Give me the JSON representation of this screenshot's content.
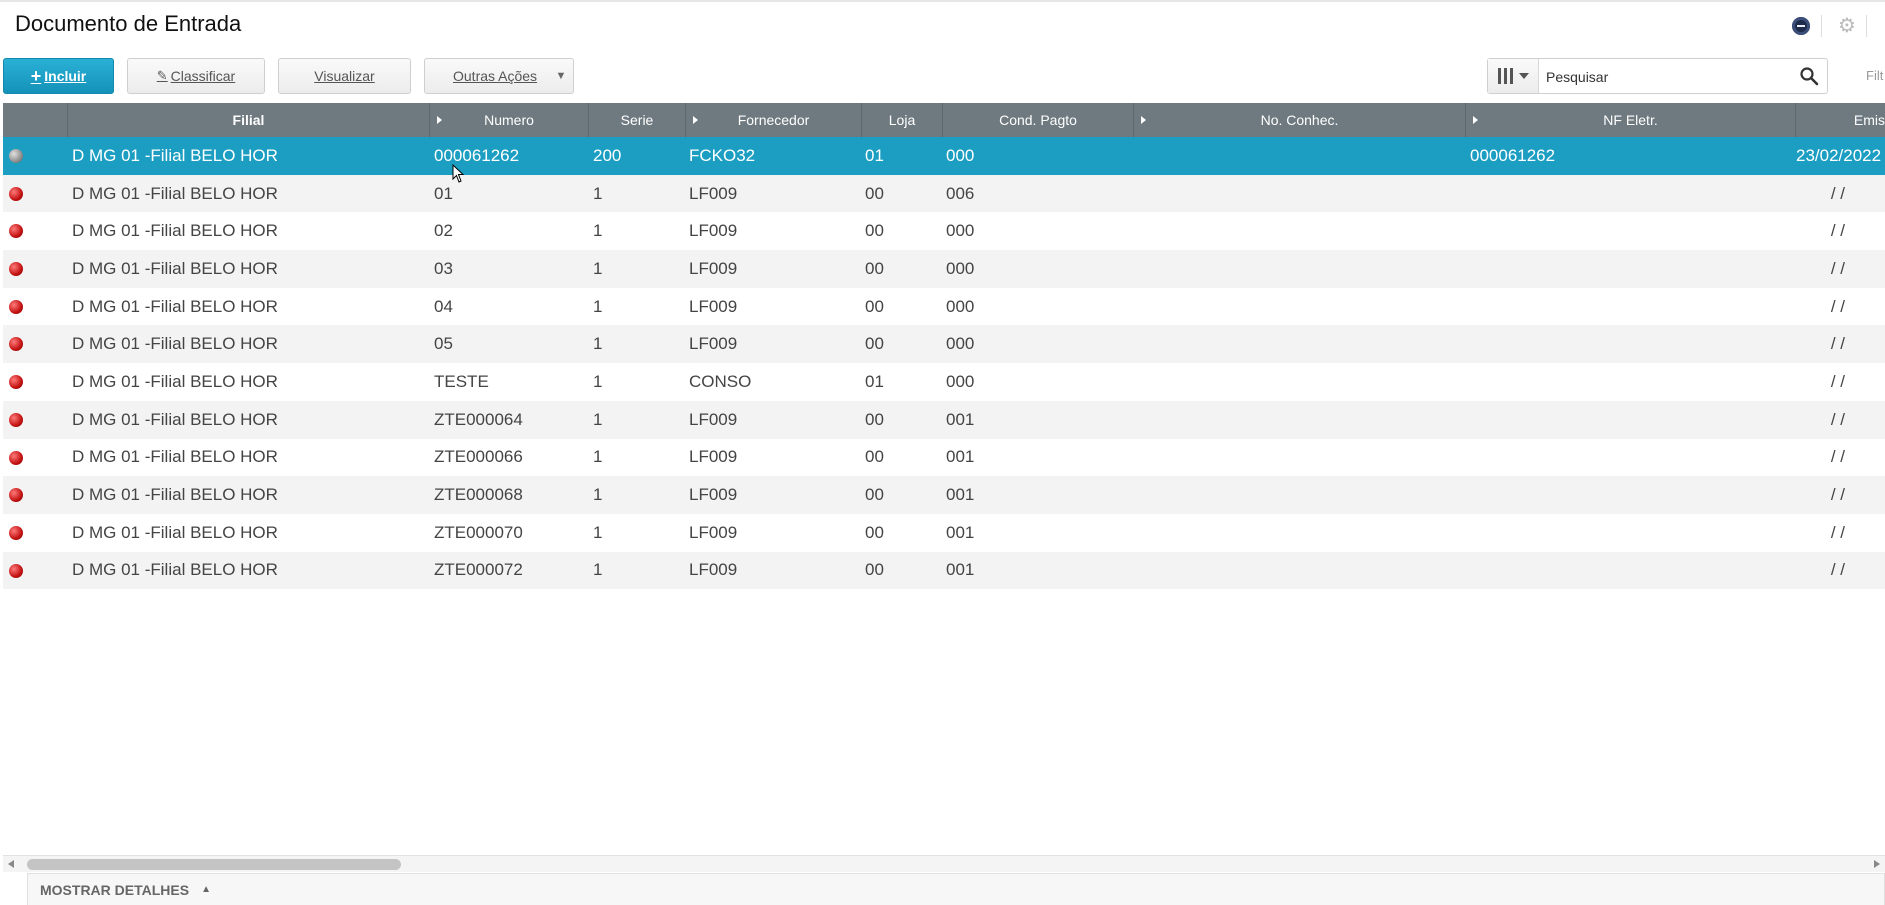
{
  "page": {
    "title": "Documento de Entrada"
  },
  "toolbar": {
    "incluir": "Incluir",
    "classificar": "Classificar",
    "visualizar": "Visualizar",
    "outras": "Outras Ações"
  },
  "search": {
    "placeholder": "Pesquisar",
    "filter_label": "Filt"
  },
  "grid": {
    "headers": [
      "",
      "Filial",
      "Numero",
      "Serie",
      "Fornecedor",
      "Loja",
      "Cond. Pagto",
      "No. Conhec.",
      "NF Eletr.",
      "Emis"
    ],
    "rows": [
      {
        "status": "gray",
        "filial": "D MG 01 -Filial BELO HOR",
        "numero": "000061262",
        "serie": "200",
        "fornecedor": "FCKO32",
        "loja": "01",
        "cond": "000",
        "conhec": "",
        "nfe": "000061262",
        "emis": "23/02/2022",
        "selected": true
      },
      {
        "status": "red",
        "filial": "D MG 01 -Filial BELO HOR",
        "numero": "01",
        "serie": "1",
        "fornecedor": "LF009",
        "loja": "00",
        "cond": "006",
        "conhec": "",
        "nfe": "",
        "emis": "/ /"
      },
      {
        "status": "red",
        "filial": "D MG 01 -Filial BELO HOR",
        "numero": "02",
        "serie": "1",
        "fornecedor": "LF009",
        "loja": "00",
        "cond": "000",
        "conhec": "",
        "nfe": "",
        "emis": "/ /"
      },
      {
        "status": "red",
        "filial": "D MG 01 -Filial BELO HOR",
        "numero": "03",
        "serie": "1",
        "fornecedor": "LF009",
        "loja": "00",
        "cond": "000",
        "conhec": "",
        "nfe": "",
        "emis": "/ /"
      },
      {
        "status": "red",
        "filial": "D MG 01 -Filial BELO HOR",
        "numero": "04",
        "serie": "1",
        "fornecedor": "LF009",
        "loja": "00",
        "cond": "000",
        "conhec": "",
        "nfe": "",
        "emis": "/ /"
      },
      {
        "status": "red",
        "filial": "D MG 01 -Filial BELO HOR",
        "numero": "05",
        "serie": "1",
        "fornecedor": "LF009",
        "loja": "00",
        "cond": "000",
        "conhec": "",
        "nfe": "",
        "emis": "/ /"
      },
      {
        "status": "red",
        "filial": "D MG 01 -Filial BELO HOR",
        "numero": "TESTE",
        "serie": "1",
        "fornecedor": "CONSO",
        "loja": "01",
        "cond": "000",
        "conhec": "",
        "nfe": "",
        "emis": "/ /"
      },
      {
        "status": "red",
        "filial": "D MG 01 -Filial BELO HOR",
        "numero": "ZTE000064",
        "serie": "1",
        "fornecedor": "LF009",
        "loja": "00",
        "cond": "001",
        "conhec": "",
        "nfe": "",
        "emis": "/ /"
      },
      {
        "status": "red",
        "filial": "D MG 01 -Filial BELO HOR",
        "numero": "ZTE000066",
        "serie": "1",
        "fornecedor": "LF009",
        "loja": "00",
        "cond": "001",
        "conhec": "",
        "nfe": "",
        "emis": "/ /"
      },
      {
        "status": "red",
        "filial": "D MG 01 -Filial BELO HOR",
        "numero": "ZTE000068",
        "serie": "1",
        "fornecedor": "LF009",
        "loja": "00",
        "cond": "001",
        "conhec": "",
        "nfe": "",
        "emis": "/ /"
      },
      {
        "status": "red",
        "filial": "D MG 01 -Filial BELO HOR",
        "numero": "ZTE000070",
        "serie": "1",
        "fornecedor": "LF009",
        "loja": "00",
        "cond": "001",
        "conhec": "",
        "nfe": "",
        "emis": "/ /"
      },
      {
        "status": "red",
        "filial": "D MG 01 -Filial BELO HOR",
        "numero": "ZTE000072",
        "serie": "1",
        "fornecedor": "LF009",
        "loja": "00",
        "cond": "001",
        "conhec": "",
        "nfe": "",
        "emis": "/ /"
      }
    ]
  },
  "footer": {
    "details": "MOSTRAR DETALHES"
  },
  "colors": {
    "header_bg": "#6f7a80",
    "selected_row": "#1b9ec2",
    "primary_button": "#1a9fc5",
    "status_red": "#c31212"
  }
}
